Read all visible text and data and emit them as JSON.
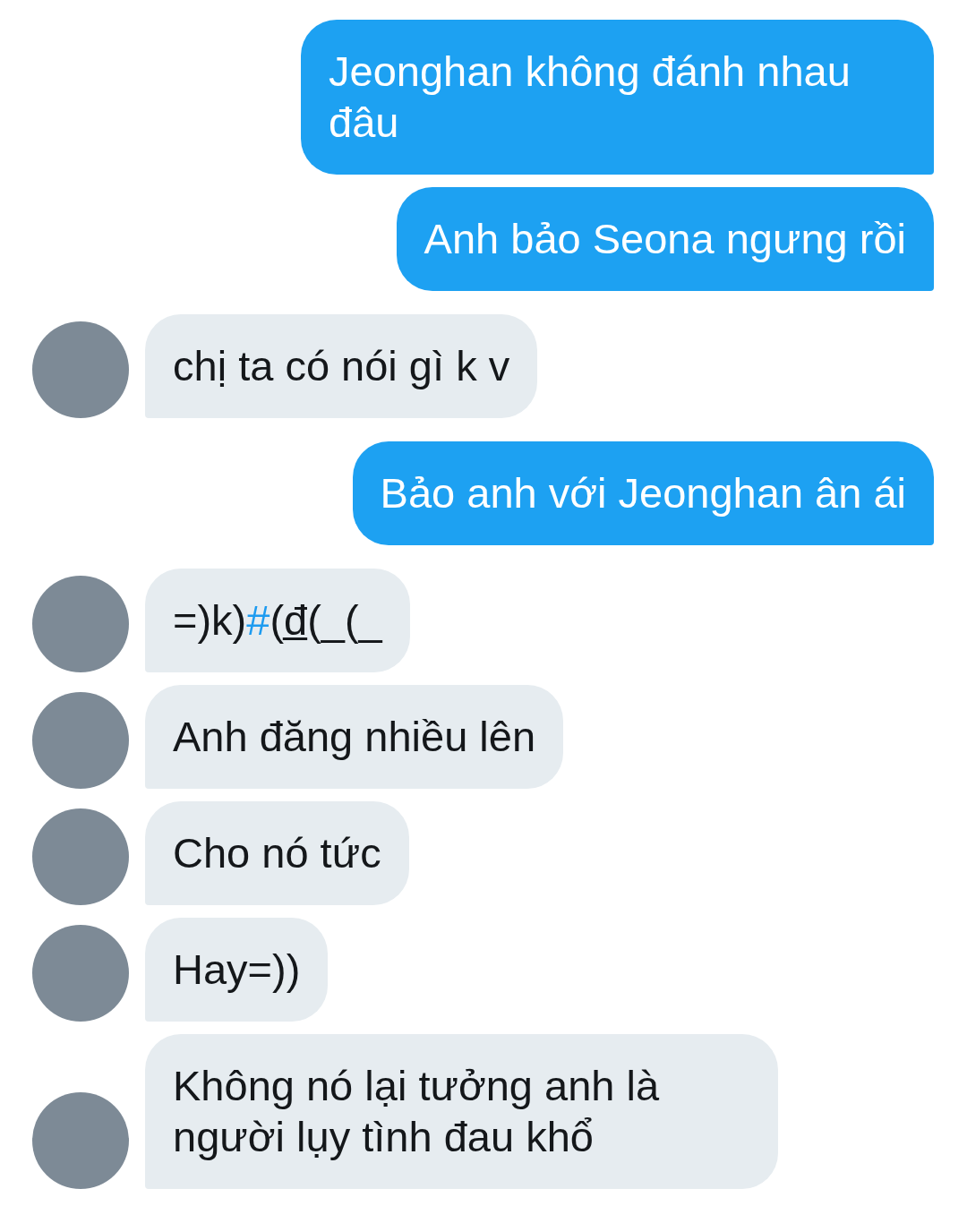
{
  "messages": [
    {
      "kind": "outgoing",
      "parts": [
        {
          "kind": "plain",
          "text": "Jeonghan không đánh nhau đâu"
        }
      ]
    },
    {
      "kind": "outgoing",
      "parts": [
        {
          "kind": "plain",
          "text": "Anh bảo Seona ngưng rồi"
        }
      ]
    },
    {
      "kind": "incoming",
      "parts": [
        {
          "kind": "plain",
          "text": "chị ta có nói gì k v"
        }
      ]
    },
    {
      "kind": "outgoing",
      "parts": [
        {
          "kind": "plain",
          "text": "Bảo anh với Jeonghan ân ái"
        }
      ]
    },
    {
      "kind": "incoming",
      "parts": [
        {
          "kind": "plain",
          "text": "=)k)"
        },
        {
          "kind": "hashtag",
          "text": "#"
        },
        {
          "kind": "plain",
          "text": "(đ̲(_(_"
        }
      ]
    },
    {
      "kind": "incoming",
      "parts": [
        {
          "kind": "plain",
          "text": "Anh đăng nhiều lên"
        }
      ]
    },
    {
      "kind": "incoming",
      "parts": [
        {
          "kind": "plain",
          "text": "Cho nó tức"
        }
      ]
    },
    {
      "kind": "incoming",
      "parts": [
        {
          "kind": "plain",
          "text": "Hay=))"
        }
      ]
    },
    {
      "kind": "incoming",
      "parts": [
        {
          "kind": "plain",
          "text": "Không nó lại tưởng anh là người lụy tình đau khổ"
        }
      ]
    }
  ]
}
